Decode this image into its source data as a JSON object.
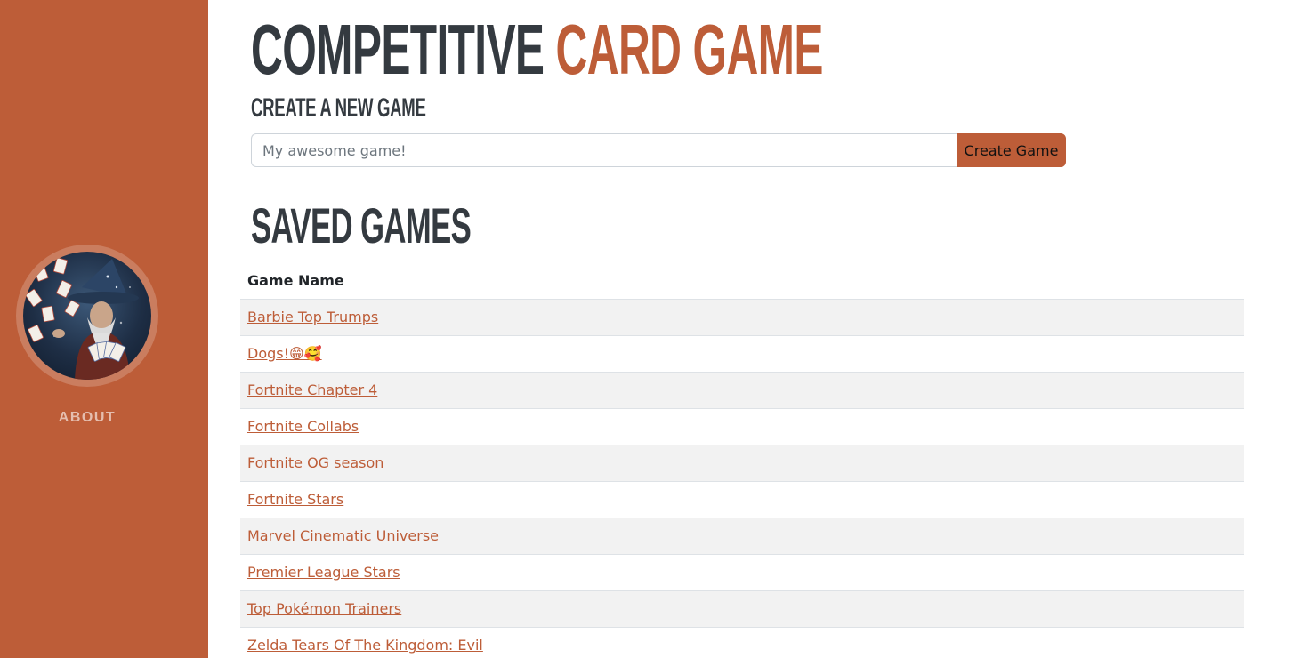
{
  "sidebar": {
    "about_label": "ABOUT",
    "avatar_icon": "wizard-with-cards-avatar"
  },
  "header": {
    "title_part1": "COMPETITIVE",
    "title_part2": "CARD GAME",
    "create_heading": "CREATE A NEW GAME"
  },
  "create_form": {
    "placeholder": "My awesome game!",
    "value": "",
    "button_label": "Create Game"
  },
  "saved": {
    "heading": "SAVED GAMES",
    "column_header": "Game Name",
    "games": [
      "Barbie Top Trumps",
      "Dogs!😁🥰",
      "Fortnite Chapter 4",
      "Fortnite Collabs",
      "Fortnite OG season",
      "Fortnite Stars",
      "Marvel Cinematic Universe",
      "Premier League Stars",
      "Top Pokémon Trainers",
      "Zelda Tears Of The Kingdom: Evil"
    ]
  },
  "colors": {
    "brand": "#bd5d38",
    "heading": "#343a40",
    "stripe": "#f2f2f2"
  }
}
